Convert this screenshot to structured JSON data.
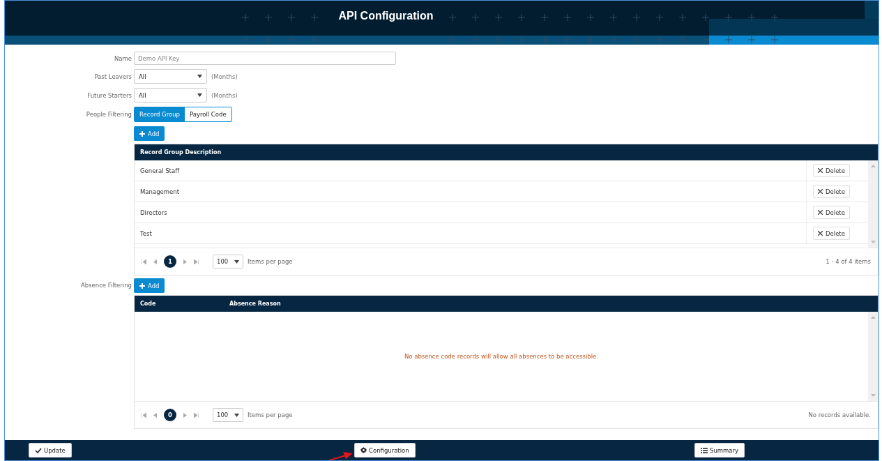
{
  "window": {
    "title": "API Configuration"
  },
  "form": {
    "name": {
      "label": "Name",
      "value": "Demo API Key"
    },
    "past_leavers": {
      "label": "Past Leavers",
      "value": "All",
      "unit": "(Months)"
    },
    "future_starters": {
      "label": "Future Starters",
      "value": "All",
      "unit": "(Months)"
    }
  },
  "people_filtering": {
    "label": "People Filtering",
    "tabs": [
      {
        "label": "Record Group",
        "selected": true
      },
      {
        "label": "Payroll Code",
        "selected": false
      }
    ],
    "add_button": "Add",
    "table": {
      "columns": [
        "Record Group Description"
      ],
      "rows": [
        {
          "description": "General Staff",
          "action": "Delete"
        },
        {
          "description": "Management",
          "action": "Delete"
        },
        {
          "description": "Directors",
          "action": "Delete"
        },
        {
          "description": "Test",
          "action": "Delete"
        }
      ],
      "pager": {
        "page": "1",
        "page_size": "100",
        "page_size_label": "Items per page",
        "summary": "1 - 4 of 4 items"
      }
    }
  },
  "absence_filtering": {
    "label": "Absence Filtering",
    "add_button": "Add",
    "table": {
      "columns": [
        "Code",
        "Absence Reason"
      ],
      "empty_message": "No absence code records will allow all absences to be accessible.",
      "pager": {
        "page": "0",
        "page_size": "100",
        "page_size_label": "Items per page",
        "summary": "No records available."
      }
    }
  },
  "footer": {
    "buttons": [
      {
        "kind": "update",
        "label": "Update"
      },
      {
        "kind": "configuration",
        "label": "Configuration"
      },
      {
        "kind": "summary",
        "label": "Summary"
      }
    ]
  }
}
